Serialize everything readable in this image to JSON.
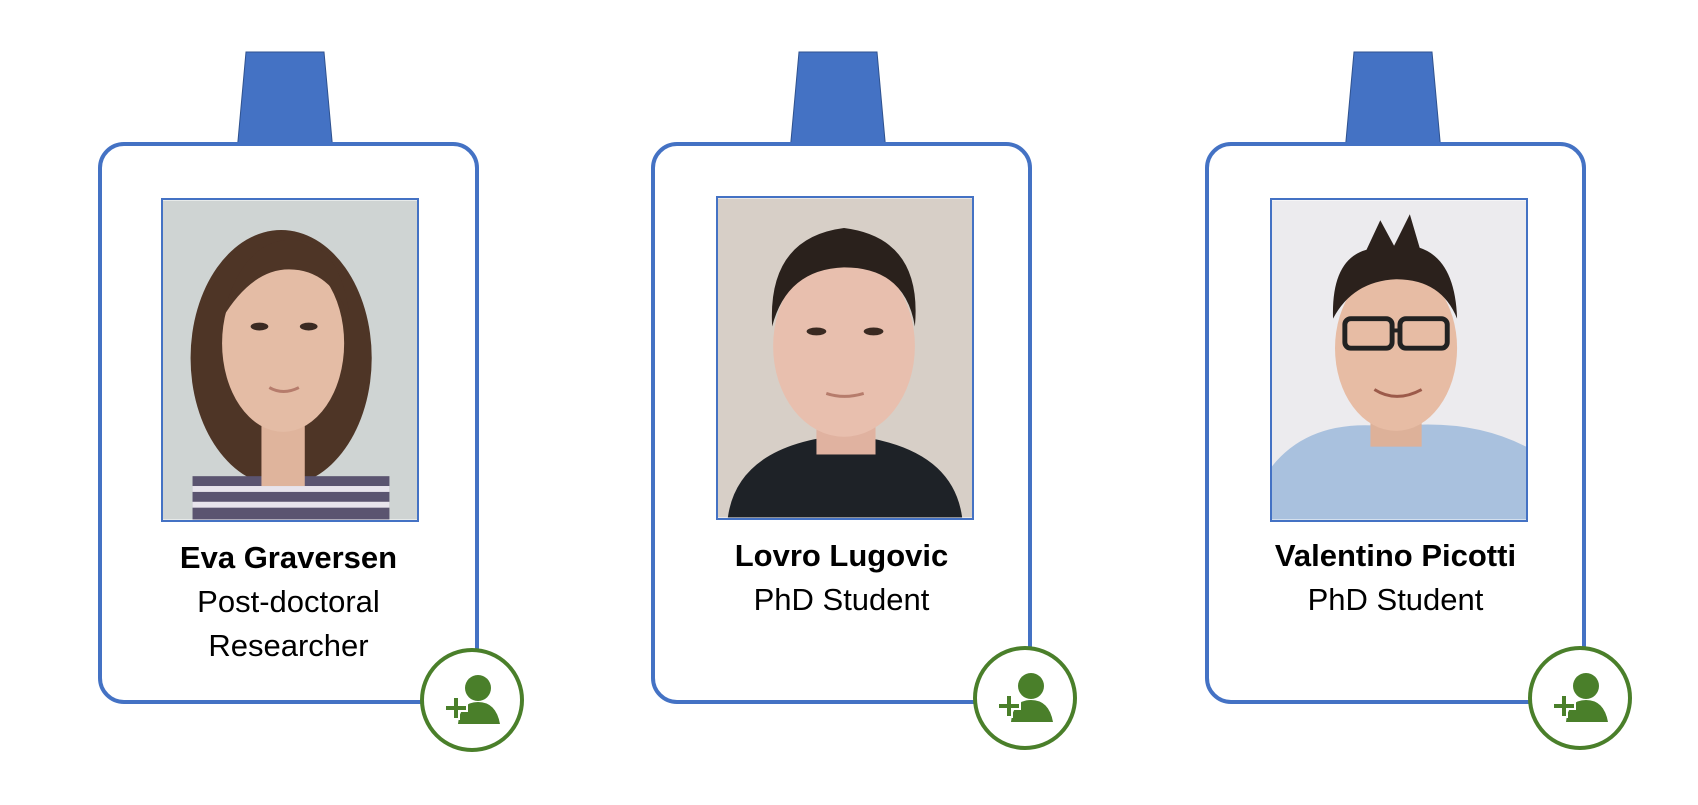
{
  "accent_color": "#4472c4",
  "action_color": "#4a7f2a",
  "people": [
    {
      "name": "Eva Graversen",
      "role_lines": [
        "Post-doctoral",
        "Researcher"
      ],
      "action_icon": "add-person-icon"
    },
    {
      "name": "Lovro Lugovic",
      "role_lines": [
        "PhD Student"
      ],
      "action_icon": "add-person-icon"
    },
    {
      "name": "Valentino Picotti",
      "role_lines": [
        "PhD Student"
      ],
      "action_icon": "add-person-icon"
    }
  ]
}
